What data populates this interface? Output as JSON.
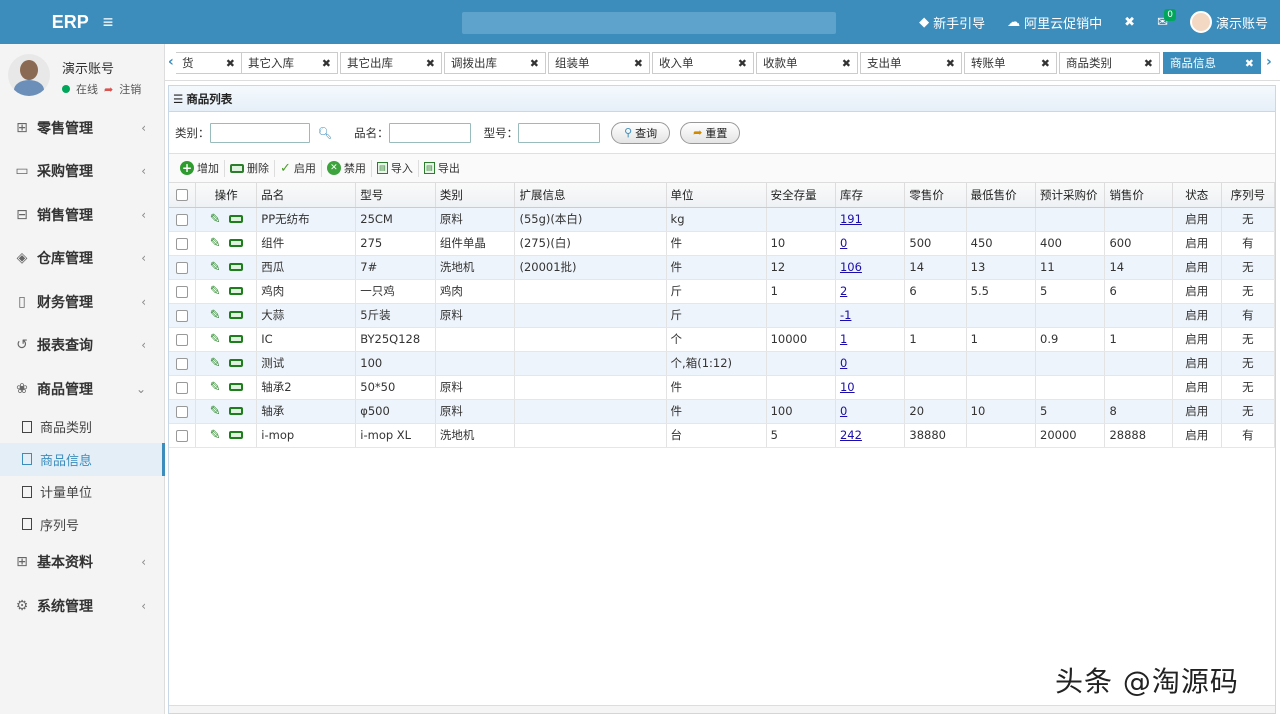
{
  "header": {
    "logo": "ERP",
    "menu_icon": "hamburger-icon",
    "links": [
      {
        "icon": "diamond-icon",
        "label": "新手引导"
      },
      {
        "icon": "cloud-icon",
        "label": "阿里云促销中"
      },
      {
        "icon": "fullscreen-icon",
        "label": ""
      },
      {
        "icon": "mail-icon",
        "label": "",
        "badge": "0"
      },
      {
        "icon": "avatar",
        "label": "演示账号"
      }
    ]
  },
  "sidebar": {
    "user_name": "演示账号",
    "status_online": "在线",
    "logout": "注销",
    "menu": [
      {
        "icon": "gift-icon",
        "label": "零售管理"
      },
      {
        "icon": "monitor-icon",
        "label": "采购管理"
      },
      {
        "icon": "briefcase-icon",
        "label": "销售管理"
      },
      {
        "icon": "layers-icon",
        "label": "仓库管理"
      },
      {
        "icon": "book-icon",
        "label": "财务管理"
      },
      {
        "icon": "history-icon",
        "label": "报表查询"
      },
      {
        "icon": "goods-icon",
        "label": "商品管理",
        "open": true
      },
      {
        "icon": "grid-icon",
        "label": "基本资料"
      },
      {
        "icon": "settings-icon",
        "label": "系统管理"
      }
    ],
    "submenu": [
      "商品类别",
      "商品信息",
      "计量单位",
      "序列号"
    ],
    "active_submenu": "商品信息"
  },
  "tabs": [
    "货",
    "其它入库",
    "其它出库",
    "调拨出库",
    "组装单",
    "收入单",
    "收款单",
    "支出单",
    "转账单",
    "商品类别",
    "商品信息"
  ],
  "active_tab": "商品信息",
  "panel": {
    "title": "商品列表",
    "filter": {
      "category_label": "类别：",
      "name_label": "品名：",
      "model_label": "型号：",
      "search_btn": "查询",
      "reset_btn": "重置"
    },
    "toolbar": [
      "增加",
      "删除",
      "启用",
      "禁用",
      "导入",
      "导出"
    ]
  },
  "table": {
    "headers": [
      "操作",
      "品名",
      "型号",
      "类别",
      "扩展信息",
      "单位",
      "安全存量",
      "库存",
      "零售价",
      "最低售价",
      "预计采购价",
      "销售价",
      "状态",
      "序列号"
    ],
    "rows": [
      [
        "PP无纺布",
        "25CM",
        "原料",
        "(55g)(本白)",
        "kg",
        "",
        "191",
        "",
        "",
        "",
        "",
        "启用",
        "无"
      ],
      [
        "组件",
        "275",
        "组件单晶",
        "(275)(白)",
        "件",
        "10",
        "0",
        "500",
        "450",
        "400",
        "600",
        "启用",
        "有"
      ],
      [
        "西瓜",
        "7#",
        "洗地机",
        "(20001批)",
        "件",
        "12",
        "106",
        "14",
        "13",
        "11",
        "14",
        "启用",
        "无"
      ],
      [
        "鸡肉",
        "一只鸡",
        "鸡肉",
        "",
        "斤",
        "1",
        "2",
        "6",
        "5.5",
        "5",
        "6",
        "启用",
        "无"
      ],
      [
        "大蒜",
        "5斤装",
        "原料",
        "",
        "斤",
        "",
        "-1",
        "",
        "",
        "",
        "",
        "启用",
        "有"
      ],
      [
        "IC",
        "BY25Q128",
        "",
        "",
        "个",
        "10000",
        "1",
        "1",
        "1",
        "0.9",
        "1",
        "启用",
        "无"
      ],
      [
        "测试",
        "100",
        "",
        "",
        "个,箱(1:12)",
        "",
        "0",
        "",
        "",
        "",
        "",
        "启用",
        "无"
      ],
      [
        "轴承2",
        "50*50",
        "原料",
        "",
        "件",
        "",
        "10",
        "",
        "",
        "",
        "",
        "启用",
        "无"
      ],
      [
        "轴承",
        "φ500",
        "原料",
        "",
        "件",
        "100",
        "0",
        "20",
        "10",
        "5",
        "8",
        "启用",
        "无"
      ],
      [
        "i-mop",
        "i-mop XL",
        "洗地机",
        "",
        "台",
        "5",
        "242",
        "38880",
        "",
        "20000",
        "28888",
        "启用",
        "有"
      ]
    ]
  },
  "watermark": "头条 @淘源码",
  "colors": {
    "primary": "#3c8dbc",
    "success": "#00a65a",
    "row_alt": "#eef4fb"
  }
}
